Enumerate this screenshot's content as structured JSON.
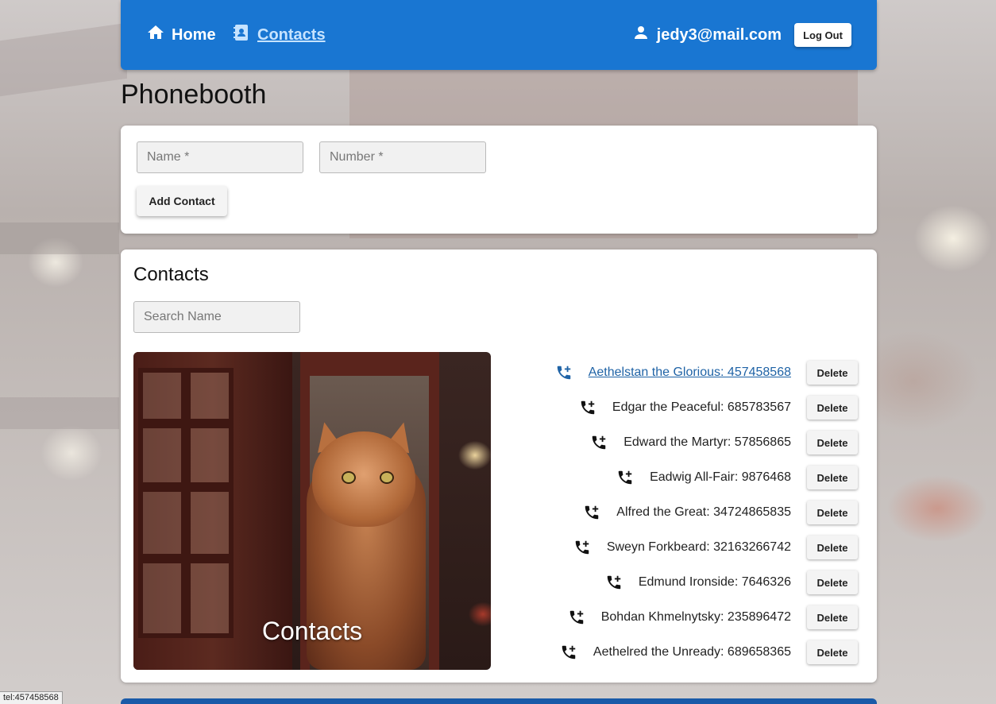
{
  "header": {
    "home_label": "Home",
    "contacts_label": "Contacts",
    "user_email": "jedy3@mail.com",
    "logout_label": "Log Out"
  },
  "page_title": "Phonebooth",
  "form": {
    "name_placeholder": "Name *",
    "number_placeholder": "Number *",
    "add_label": "Add Contact"
  },
  "contacts_section": {
    "title": "Contacts",
    "search_placeholder": "Search Name",
    "image_caption": "Contacts",
    "delete_label": "Delete",
    "items": [
      {
        "text": "Aethelstan the Glorious: 457458568"
      },
      {
        "text": "Edgar the Peaceful: 685783567"
      },
      {
        "text": "Edward the Martyr: 57856865"
      },
      {
        "text": "Eadwig All-Fair: 9876468"
      },
      {
        "text": "Alfred the Great: 34724865835"
      },
      {
        "text": "Sweyn Forkbeard: 32163266742"
      },
      {
        "text": "Edmund Ironside: 7646326"
      },
      {
        "text": "Bohdan Khmelnytsky: 235896472"
      },
      {
        "text": "Aethelred the Unready: 689658365"
      }
    ]
  },
  "status_bar": {
    "link": "tel:457458568"
  },
  "colors": {
    "header": "#1976d2",
    "active_link": "#1f63a6"
  },
  "icons": {
    "home": "home-icon",
    "contacts": "contacts-book-icon",
    "user": "person-icon",
    "add_call": "add-call-icon"
  }
}
